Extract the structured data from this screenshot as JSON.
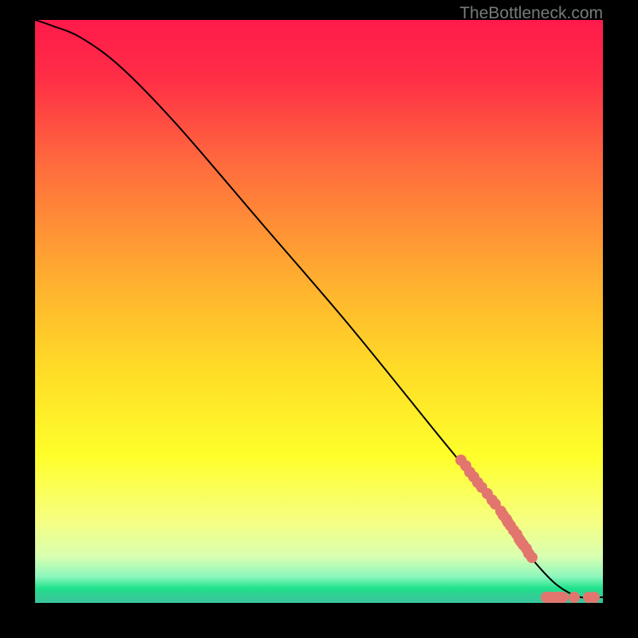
{
  "watermark": "TheBottleneck.com",
  "chart_data": {
    "type": "line",
    "title": "",
    "xlabel": "",
    "ylabel": "",
    "xlim": [
      0,
      100
    ],
    "ylim": [
      0,
      100
    ],
    "background_gradient": {
      "stops": [
        {
          "pos": 0.0,
          "color": "#ff1a4b"
        },
        {
          "pos": 0.1,
          "color": "#ff2e46"
        },
        {
          "pos": 0.25,
          "color": "#ff6c3d"
        },
        {
          "pos": 0.45,
          "color": "#ffb02f"
        },
        {
          "pos": 0.6,
          "color": "#ffdc27"
        },
        {
          "pos": 0.75,
          "color": "#feff2b"
        },
        {
          "pos": 0.86,
          "color": "#f6ff82"
        },
        {
          "pos": 0.92,
          "color": "#d9ffb0"
        },
        {
          "pos": 0.955,
          "color": "#8cf7bd"
        },
        {
          "pos": 0.975,
          "color": "#1fe28b"
        },
        {
          "pos": 0.985,
          "color": "#2fd193"
        },
        {
          "pos": 1.0,
          "color": "#3ac59d"
        }
      ]
    },
    "series": [
      {
        "name": "curve",
        "type": "line",
        "color": "#000000",
        "x": [
          0,
          3,
          8,
          15,
          25,
          40,
          55,
          70,
          80,
          85,
          88,
          92,
          96,
          100
        ],
        "y": [
          100,
          99,
          97,
          92,
          82,
          65,
          48,
          30,
          18,
          11,
          7,
          3,
          1,
          1
        ]
      },
      {
        "name": "cluster-points",
        "type": "scatter",
        "color": "#e2766e",
        "points": [
          {
            "x": 75.0,
            "y": 24.5
          },
          {
            "x": 75.8,
            "y": 23.5
          },
          {
            "x": 76.6,
            "y": 22.5
          },
          {
            "x": 77.3,
            "y": 21.6
          },
          {
            "x": 78.0,
            "y": 20.7
          },
          {
            "x": 78.7,
            "y": 19.8
          },
          {
            "x": 79.6,
            "y": 18.7
          },
          {
            "x": 80.5,
            "y": 17.6
          },
          {
            "x": 81.0,
            "y": 17.0
          },
          {
            "x": 82.0,
            "y": 15.7
          },
          {
            "x": 82.5,
            "y": 15.0
          },
          {
            "x": 83.0,
            "y": 14.3
          },
          {
            "x": 83.3,
            "y": 13.8
          },
          {
            "x": 83.7,
            "y": 13.3
          },
          {
            "x": 84.3,
            "y": 12.5
          },
          {
            "x": 84.8,
            "y": 11.8
          },
          {
            "x": 85.3,
            "y": 11.0
          },
          {
            "x": 85.6,
            "y": 10.5
          },
          {
            "x": 86.0,
            "y": 10.0
          },
          {
            "x": 86.5,
            "y": 9.3
          },
          {
            "x": 87.0,
            "y": 8.5
          },
          {
            "x": 87.5,
            "y": 7.8
          },
          {
            "x": 90.0,
            "y": 1.0
          },
          {
            "x": 90.6,
            "y": 1.0
          },
          {
            "x": 91.2,
            "y": 1.0
          },
          {
            "x": 91.8,
            "y": 1.0
          },
          {
            "x": 92.4,
            "y": 1.0
          },
          {
            "x": 93.0,
            "y": 1.0
          },
          {
            "x": 95.0,
            "y": 1.0
          },
          {
            "x": 97.5,
            "y": 1.0
          },
          {
            "x": 98.5,
            "y": 1.0
          }
        ]
      }
    ]
  }
}
